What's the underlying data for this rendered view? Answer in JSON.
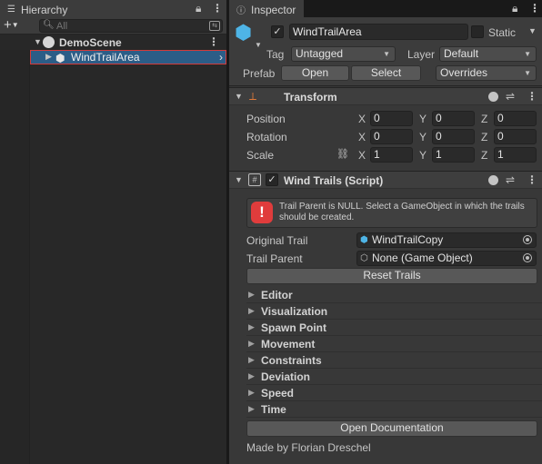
{
  "hierarchy": {
    "tab_label": "Hierarchy",
    "tab_icon": "list-icon",
    "add_button_label": "+",
    "search_placeholder": "All",
    "scene_name": "DemoScene",
    "selected_object": "WindTrailArea"
  },
  "inspector": {
    "tab_label": "Inspector",
    "tab_icon": "info-icon",
    "header": {
      "object_name": "WindTrailArea",
      "active": true,
      "static_label": "Static",
      "static_checked": false,
      "tag_label": "Tag",
      "tag_value": "Untagged",
      "layer_label": "Layer",
      "layer_value": "Default",
      "prefab_label": "Prefab",
      "open_label": "Open",
      "select_label": "Select",
      "overrides_label": "Overrides"
    },
    "transform": {
      "title": "Transform",
      "rows": [
        {
          "label": "Position",
          "x": "0",
          "y": "0",
          "z": "0"
        },
        {
          "label": "Rotation",
          "x": "0",
          "y": "0",
          "z": "0"
        },
        {
          "label": "Scale",
          "x": "1",
          "y": "1",
          "z": "1"
        }
      ],
      "axis_labels": [
        "X",
        "Y",
        "Z"
      ]
    },
    "script": {
      "title": "Wind Trails (Script)",
      "enabled": true,
      "error_message": "Trail Parent is NULL. Select a GameObject in which the trails should be created.",
      "original_trail_label": "Original Trail",
      "original_trail_value": "WindTrailCopy",
      "trail_parent_label": "Trail Parent",
      "trail_parent_value": "None (Game Object)",
      "reset_button": "Reset Trails",
      "foldouts": [
        "Editor",
        "Visualization",
        "Spawn Point",
        "Movement",
        "Constraints",
        "Deviation",
        "Speed",
        "Time"
      ],
      "doc_button": "Open Documentation",
      "credit": "Made by Florian Dreschel"
    }
  },
  "colors": {
    "panel": "#383838",
    "selection": "#2c5d87",
    "selection_outline": "#d43b3b",
    "cube_accent": "#4eb4e6",
    "error": "#e03c3c"
  }
}
